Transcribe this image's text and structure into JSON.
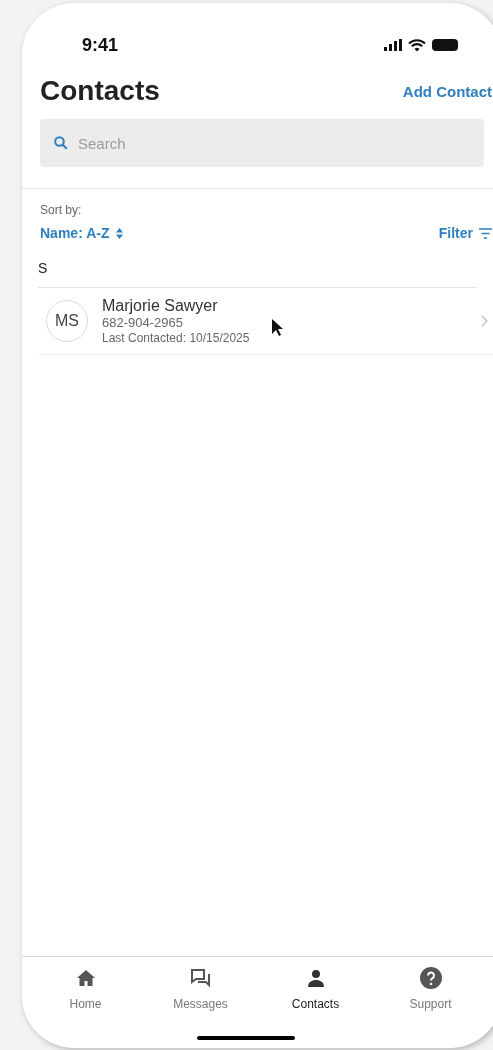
{
  "status_bar": {
    "time": "9:41"
  },
  "header": {
    "title": "Contacts",
    "action": "Add Contact"
  },
  "search": {
    "placeholder": "Search"
  },
  "sort": {
    "label": "Sort by:",
    "value": "Name: A-Z",
    "filter": "Filter"
  },
  "sections": [
    {
      "letter": "S",
      "contacts": [
        {
          "initials": "MS",
          "name": "Marjorie Sawyer",
          "phone": "682-904-2965",
          "last_contacted": "Last Contacted: 10/15/2025"
        }
      ]
    }
  ],
  "tabs": [
    {
      "label": "Home",
      "kind": "home",
      "selected": false
    },
    {
      "label": "Messages",
      "kind": "messages",
      "selected": false
    },
    {
      "label": "Contacts",
      "kind": "contacts",
      "selected": true
    },
    {
      "label": "Support",
      "kind": "support",
      "selected": false
    }
  ]
}
